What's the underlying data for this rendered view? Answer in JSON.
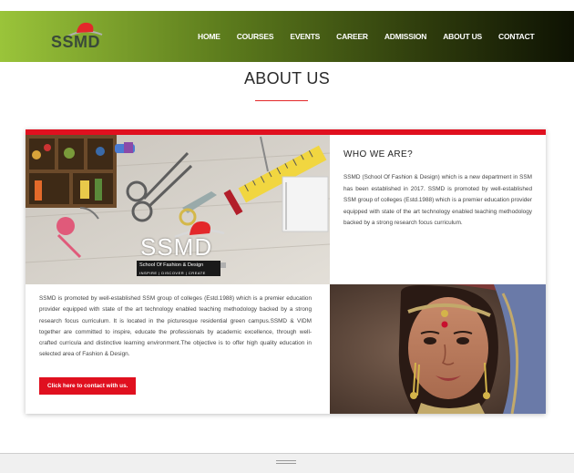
{
  "header": {
    "logo_text": "SSMD",
    "nav": [
      "HOME",
      "COURSES",
      "EVENTS",
      "CAREER",
      "ADMISSION",
      "ABOUT US",
      "CONTACT"
    ]
  },
  "page": {
    "title": "ABOUT US"
  },
  "who_we_are": {
    "title": "WHO WE ARE?",
    "body": "SSMD (School Of Fashion & Design) which is a new department in SSM has been established in 2017. SSMD is promoted by well-established SSM group of colleges (Estd.1988) which is a premier education provider equipped with state of the art technology enabled teaching methodology backed by a strong research focus curriculum."
  },
  "about": {
    "body": "SSMD is promoted by well-established SSM group of colleges (Estd.1988) which is a premier education provider equipped with state of the art technology enabled teaching methodology backed by a strong research focus curriculum. It is located in the picturesque residential green campus.SSMD & VIDM together are committed to inspire, educate the professionals by academic excellence, through well-crafted curricula and distinctive learning environment.The objective is to offer high quality education in selected area of Fashion & Design.",
    "button_label": "Click here to contact with us."
  },
  "banner_logo": {
    "text": "SSMD",
    "subtitle": "School Of Fashion & Design",
    "tagline": "INSPIRE | DISCOVER | CREATE"
  },
  "colors": {
    "accent": "#e0101f",
    "nav_start": "#9ac43a",
    "nav_end": "#0e1203"
  }
}
